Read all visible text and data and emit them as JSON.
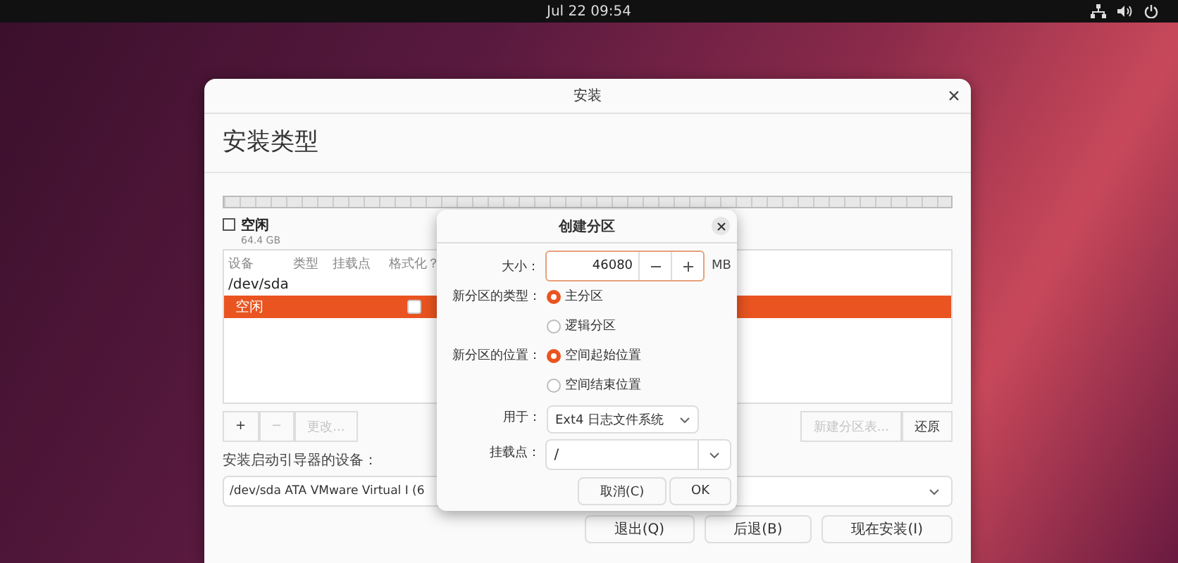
{
  "top_bar": {
    "clock": "Jul 22  09:54"
  },
  "window": {
    "title": "安装",
    "heading": "安装类型",
    "legend": {
      "label": "空闲",
      "size": "64.4 GB"
    },
    "table": {
      "columns": [
        "设备",
        "类型",
        "挂载点",
        "格式化？"
      ],
      "rows": [
        {
          "device": "/dev/sda",
          "selected": false
        },
        {
          "device": "空闲",
          "selected": true,
          "format_checked": false
        }
      ]
    },
    "partition_buttons": [
      {
        "label": "+",
        "disabled": false
      },
      {
        "label": "−",
        "disabled": true
      },
      {
        "label": "更改...",
        "disabled": true
      }
    ],
    "table_buttons": [
      {
        "label": "新建分区表...",
        "disabled": true
      },
      {
        "label": "还原",
        "disabled": false
      }
    ],
    "bootloader_label": "安装启动引导器的设备：",
    "bootloader_value": "/dev/sda ATA VMware Virtual I (6",
    "buttons": [
      "退出(Q)",
      "后退(B)",
      "现在安装(I)"
    ]
  },
  "dialog": {
    "title": "创建分区",
    "size": {
      "label": "大小：",
      "value": "46080",
      "unit": "MB"
    },
    "type": {
      "label": "新分区的类型：",
      "options": [
        {
          "label": "主分区",
          "selected": true
        },
        {
          "label": "逻辑分区",
          "selected": false
        }
      ]
    },
    "location": {
      "label": "新分区的位置：",
      "options": [
        {
          "label": "空间起始位置",
          "selected": true
        },
        {
          "label": "空间结束位置",
          "selected": false
        }
      ]
    },
    "use_as": {
      "label": "用于：",
      "value": "Ext4 日志文件系统"
    },
    "mount": {
      "label": "挂载点：",
      "value": "/"
    },
    "buttons": [
      "取消(C)",
      "OK"
    ]
  }
}
